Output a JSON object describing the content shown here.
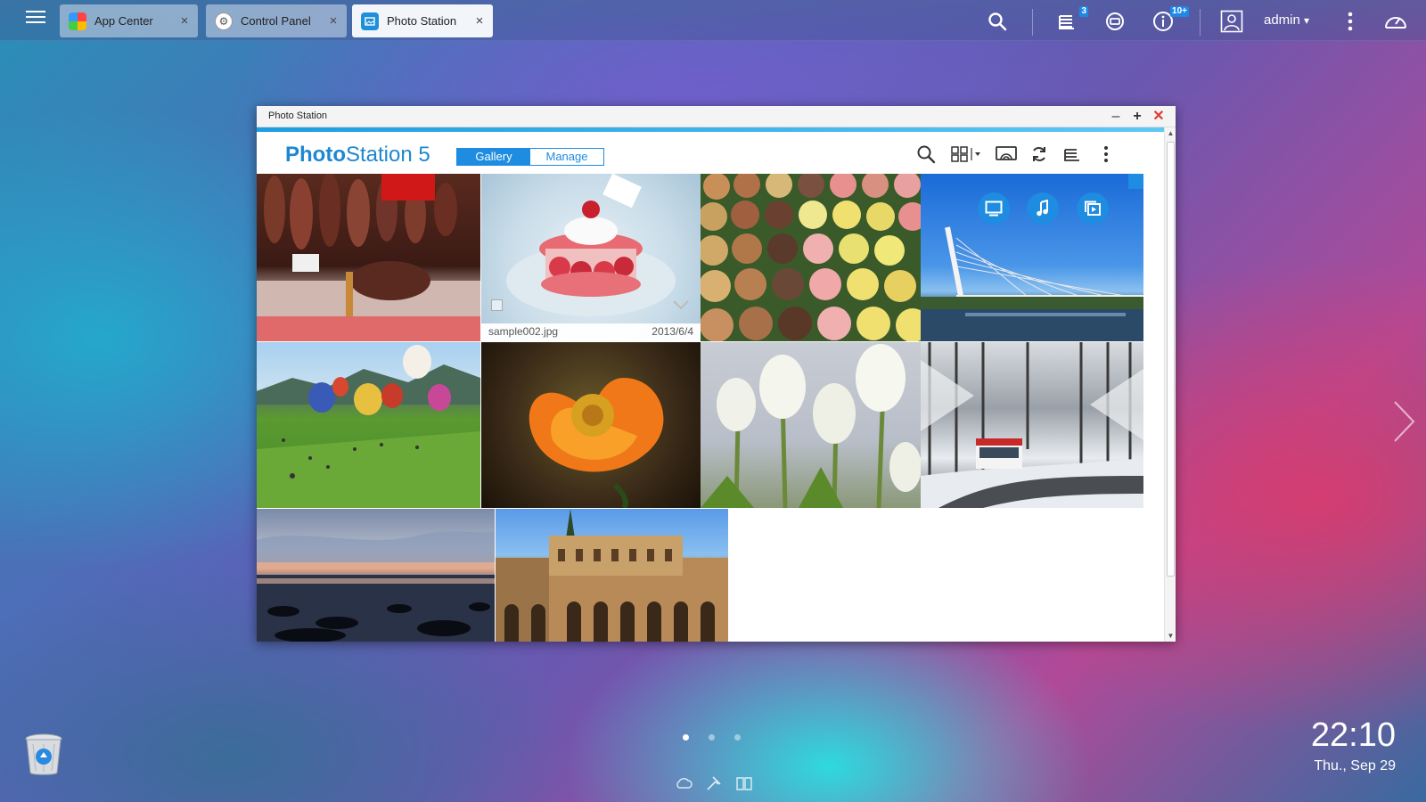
{
  "taskbar": {
    "tabs": [
      {
        "label": "App Center",
        "icon": "app-center-icon"
      },
      {
        "label": "Control Panel",
        "icon": "control-panel-icon"
      },
      {
        "label": "Photo Station",
        "icon": "photo-station-icon"
      }
    ],
    "close_glyph": "×",
    "badges": {
      "tasks": "3",
      "notifications": "10+"
    },
    "user": "admin",
    "user_caret": "▾"
  },
  "window": {
    "title": "Photo Station",
    "app_name_bold": "Photo",
    "app_name_rest": "Station 5",
    "mode_tabs": [
      {
        "label": "Gallery",
        "selected": true
      },
      {
        "label": "Manage",
        "selected": false
      }
    ],
    "hover_photo": {
      "filename": "sample002.jpg",
      "date": "2013/6/4"
    },
    "photos": [
      {
        "subject": "cured hams hanging at a market stall"
      },
      {
        "subject": "raspberry macaron dessert"
      },
      {
        "subject": "rows of colorful macarons"
      },
      {
        "subject": "white cable-stayed bridge over a river"
      },
      {
        "subject": "hot air balloons over a grassy field"
      },
      {
        "subject": "orange poppy flower close-up"
      },
      {
        "subject": "white tulips"
      },
      {
        "subject": "bus on a snowy forest road"
      },
      {
        "subject": "sunset over a rocky shoreline"
      },
      {
        "subject": "moorish palace courtyard with arches"
      }
    ]
  },
  "desktop": {
    "clock": {
      "time": "22:10",
      "date": "Thu., Sep 29"
    },
    "page_count": 3,
    "current_page": 1
  },
  "colors": {
    "accent": "#1e8ce0",
    "window_close": "#e53935",
    "badge": "#1e88e5"
  }
}
